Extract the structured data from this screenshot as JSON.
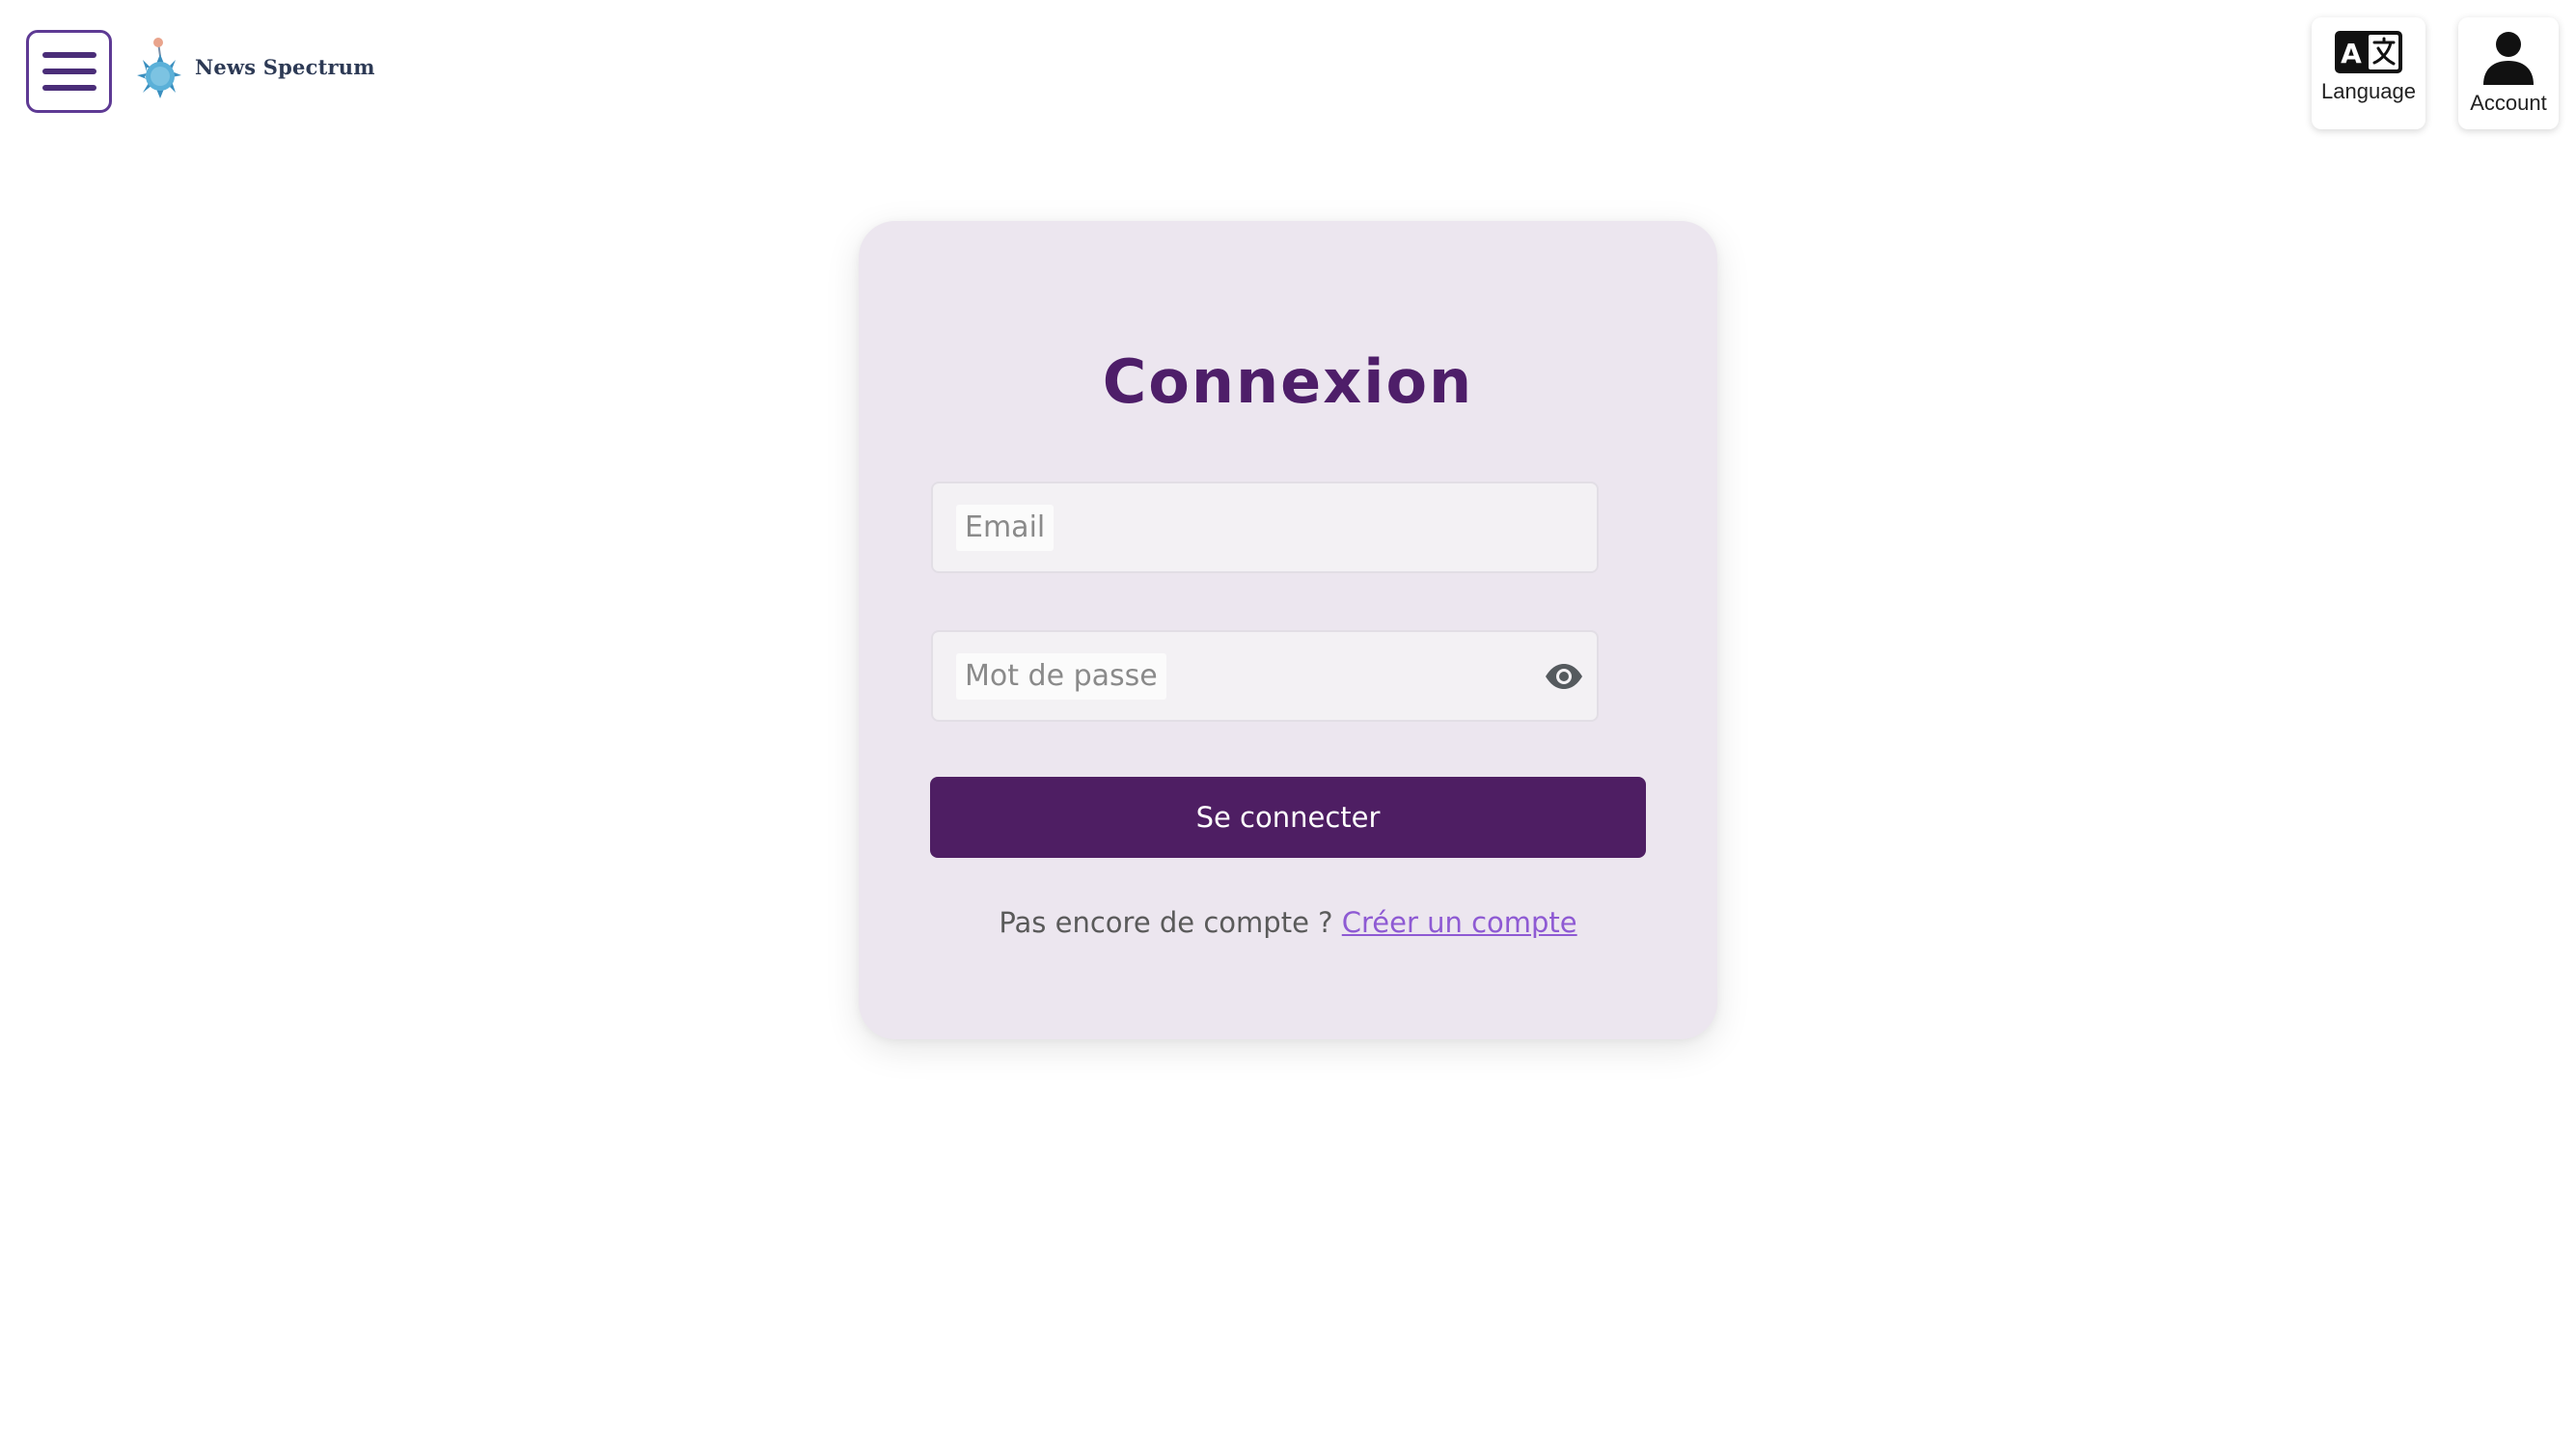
{
  "header": {
    "menu_label": "",
    "logo_text": "News Spectrum",
    "language_label": "Language",
    "account_label": "Account"
  },
  "login": {
    "title": "Connexion",
    "email_label": "Email",
    "email_value": "",
    "password_label": "Mot de passe",
    "password_value": "",
    "submit_label": "Se connecter",
    "signup_prompt": "Pas encore de compte ?",
    "signup_link": "Créer un compte"
  },
  "icons": {
    "menu": "hamburger-icon",
    "logo": "news-spectrum-logo",
    "language": "translate-icon",
    "account": "person-icon",
    "password_toggle": "eye-icon"
  },
  "colors": {
    "brand": "#4e1e63",
    "title": "#4e1e69",
    "link": "#8e5ad3",
    "card_bg": "#ece6ef",
    "menu_border": "#5e3a94"
  }
}
